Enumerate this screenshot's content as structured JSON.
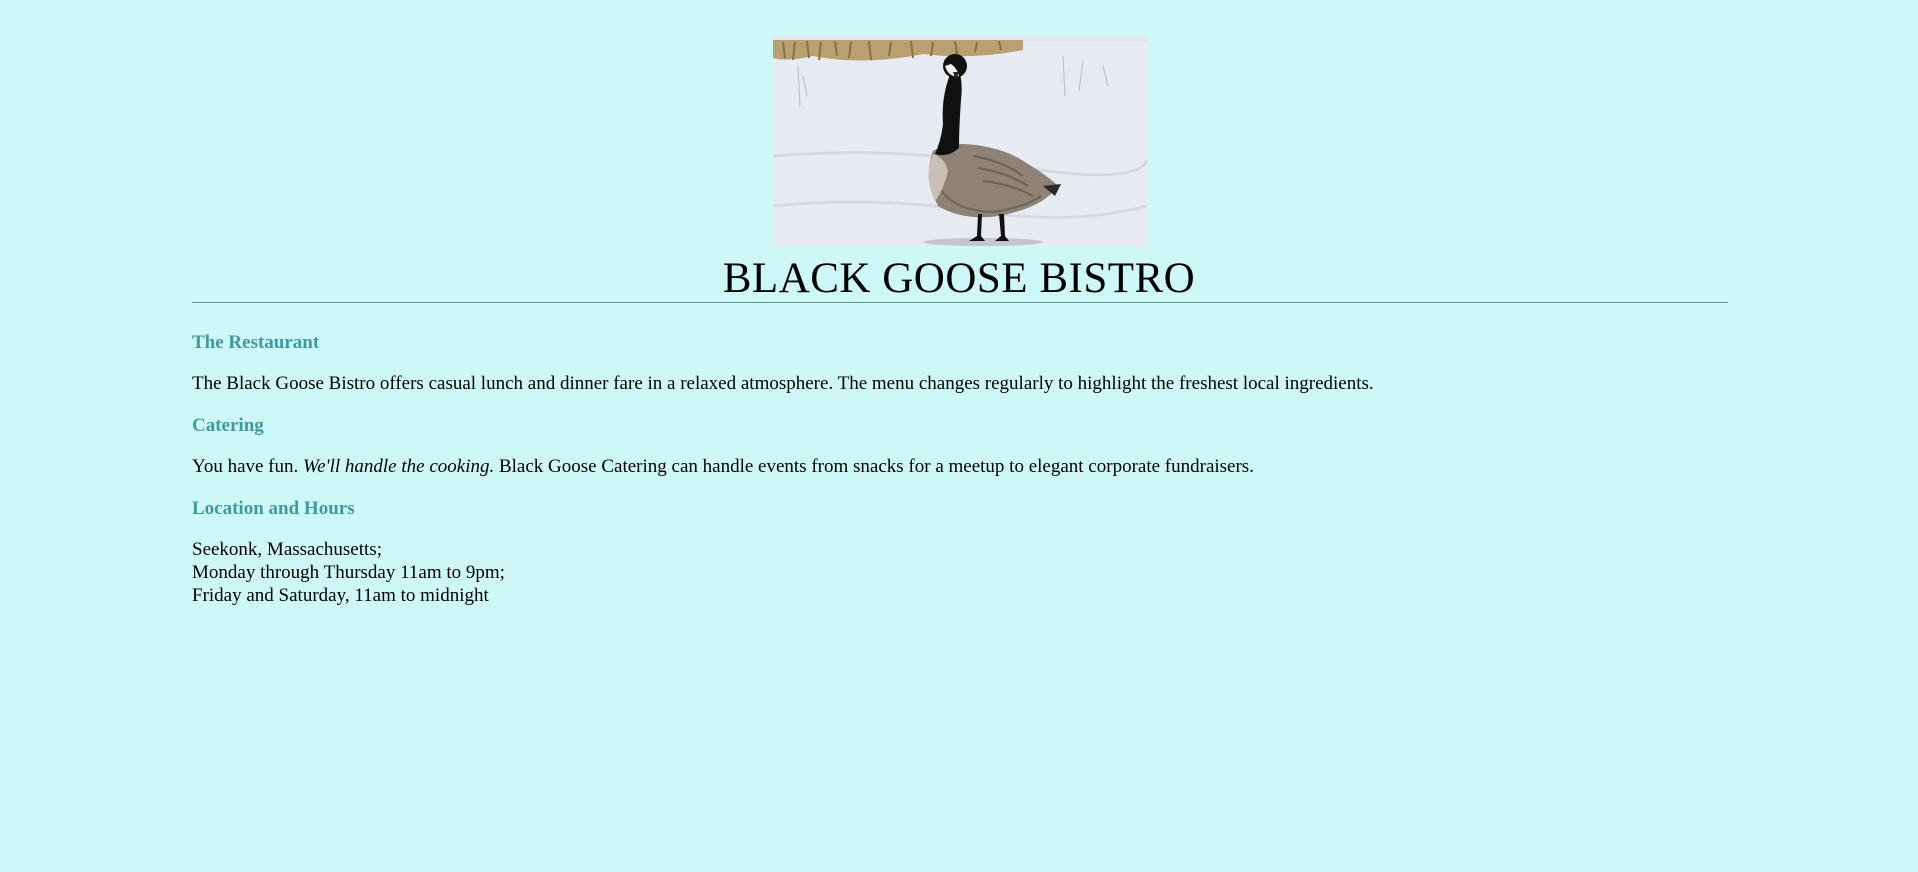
{
  "header": {
    "image_alt": "Black goose standing in the snow",
    "title": "BLACK GOOSE BISTRO"
  },
  "sections": [
    {
      "heading": "The Restaurant",
      "text": "The Black Goose Bistro offers casual lunch and dinner fare in a relaxed atmosphere. The menu changes regularly to highlight the freshest local ingredients."
    },
    {
      "heading": "Catering",
      "text_before": "You have fun. ",
      "text_emphasis": "We'll handle the cooking.",
      "text_after": " Black Goose Catering can handle events from snacks for a meetup to elegant corporate fundraisers."
    },
    {
      "heading": "Location and Hours",
      "lines": [
        "Seekonk, Massachusetts;",
        "Monday through Thursday 11am to 9pm;",
        "Friday and Saturday, 11am to midnight"
      ]
    }
  ],
  "colors": {
    "background": "#cef8f8",
    "heading": "#3f9b9b",
    "rule": "#5f8f93"
  }
}
